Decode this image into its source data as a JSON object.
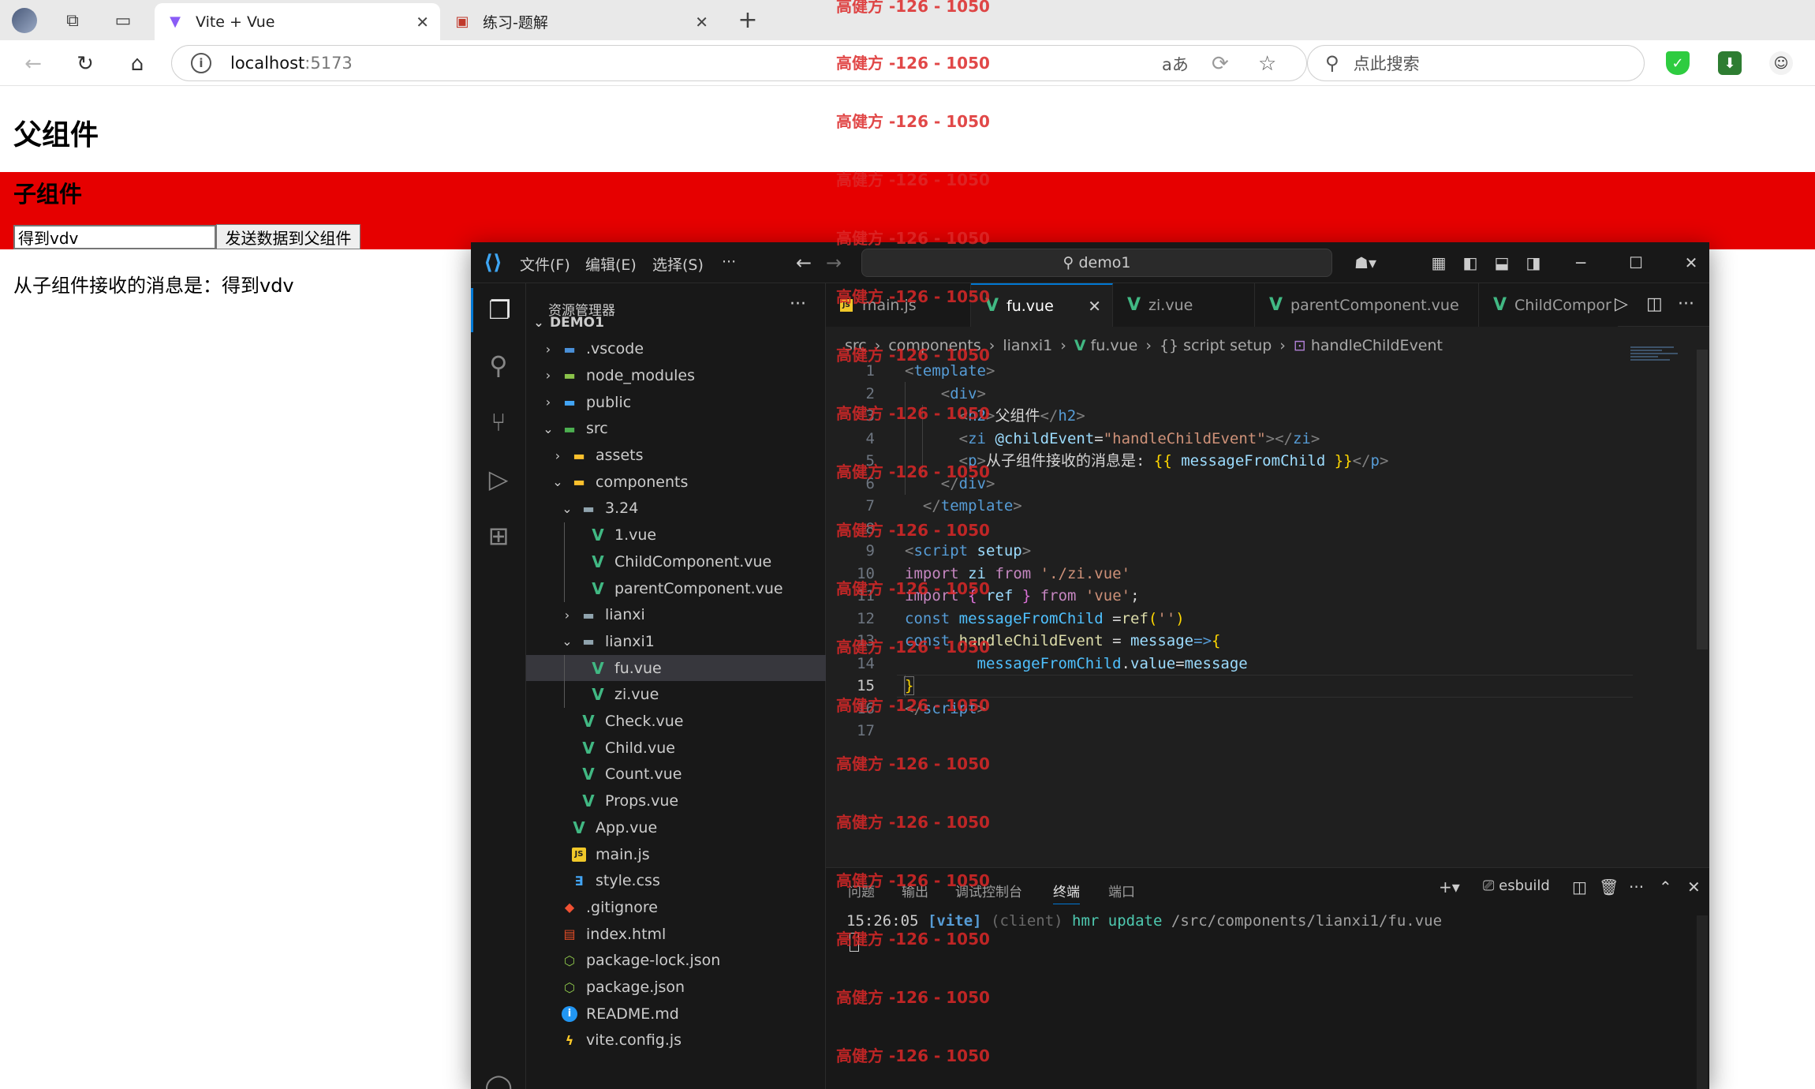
{
  "browser": {
    "tabs": [
      {
        "title": "Vite + Vue",
        "active": true
      },
      {
        "title": "练习-题解",
        "active": false
      }
    ],
    "address": {
      "host": "localhost",
      "port": ":5173"
    },
    "search_placeholder": "点此搜索",
    "translate_label": "aあ"
  },
  "page": {
    "parent_title": "父组件",
    "child_title": "子组件",
    "child_input_value": "得到vdv",
    "send_button": "发送数据到父组件",
    "received_message": "从子组件接收的消息是：得到vdv",
    "child_bg_color": "#e60000"
  },
  "watermark": "高健方 -126 - 1050",
  "vscode": {
    "menus": [
      "文件(F)",
      "编辑(E)",
      "选择(S)",
      "···"
    ],
    "command_center": "demo1",
    "explorer_title": "资源管理器",
    "tree": [
      {
        "label": "DEMO1",
        "type": "root",
        "open": true
      },
      {
        "label": ".vscode",
        "type": "folder-vs",
        "open": false
      },
      {
        "label": "node_modules",
        "type": "folder-nm",
        "open": false
      },
      {
        "label": "public",
        "type": "folder-pub",
        "open": false
      },
      {
        "label": "src",
        "type": "folder-src",
        "open": true
      },
      {
        "label": "assets",
        "type": "folder-y",
        "open": false
      },
      {
        "label": "components",
        "type": "folder-y",
        "open": true
      },
      {
        "label": "3.24",
        "type": "folder-b",
        "open": true
      },
      {
        "label": "1.vue",
        "type": "vue"
      },
      {
        "label": "ChildComponent.vue",
        "type": "vue"
      },
      {
        "label": "parentComponent.vue",
        "type": "vue"
      },
      {
        "label": "lianxi",
        "type": "folder-b",
        "open": false
      },
      {
        "label": "lianxi1",
        "type": "folder-b",
        "open": true
      },
      {
        "label": "fu.vue",
        "type": "vue",
        "selected": true
      },
      {
        "label": "zi.vue",
        "type": "vue"
      },
      {
        "label": "Check.vue",
        "type": "vue"
      },
      {
        "label": "Child.vue",
        "type": "vue"
      },
      {
        "label": "Count.vue",
        "type": "vue"
      },
      {
        "label": "Props.vue",
        "type": "vue"
      },
      {
        "label": "App.vue",
        "type": "vue"
      },
      {
        "label": "main.js",
        "type": "js"
      },
      {
        "label": "style.css",
        "type": "css"
      },
      {
        "label": ".gitignore",
        "type": "git"
      },
      {
        "label": "index.html",
        "type": "html"
      },
      {
        "label": "package-lock.json",
        "type": "json"
      },
      {
        "label": "package.json",
        "type": "json"
      },
      {
        "label": "README.md",
        "type": "info"
      },
      {
        "label": "vite.config.js",
        "type": "bolt"
      }
    ],
    "editor_tabs": [
      {
        "label": "main.js",
        "type": "js"
      },
      {
        "label": "fu.vue",
        "type": "vue",
        "active": true
      },
      {
        "label": "zi.vue",
        "type": "vue"
      },
      {
        "label": "parentComponent.vue",
        "type": "vue"
      },
      {
        "label": "ChildCompor",
        "type": "vue"
      }
    ],
    "breadcrumbs": [
      "src",
      "components",
      "lianxi1",
      "fu.vue",
      "{} script setup",
      "handleChildEvent"
    ],
    "current_line": 15,
    "line_numbers": [
      "1",
      "2",
      "3",
      "4",
      "5",
      "6",
      "7",
      "8",
      "9",
      "10",
      "11",
      "12",
      "13",
      "14",
      "15",
      "16",
      "17"
    ],
    "panel_tabs": [
      "问题",
      "输出",
      "调试控制台",
      "终端",
      "端口"
    ],
    "active_panel_tab": "终端",
    "terminal_profile": "esbuild",
    "terminal": {
      "time": "15:26:05",
      "tag": "[vite]",
      "scope": "(client)",
      "action": "hmr update",
      "path": "/src/components/lianxi1/fu.vue"
    }
  }
}
